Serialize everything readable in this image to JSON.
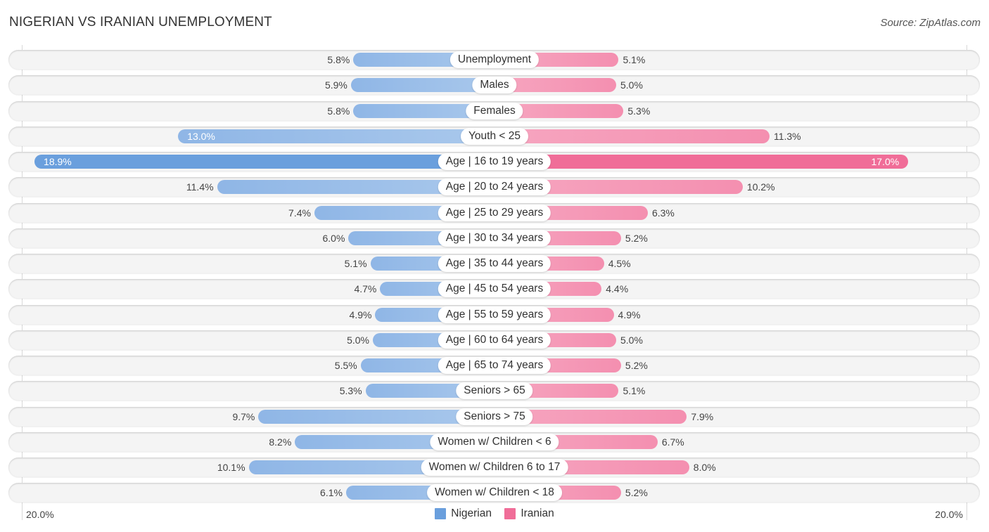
{
  "header": {
    "title": "NIGERIAN VS IRANIAN UNEMPLOYMENT",
    "source": "Source: ZipAtlas.com"
  },
  "colors": {
    "nigerian": "#6a9fdd",
    "iranian": "#f06d98",
    "nigerian_light": "#a3c4ea",
    "iranian_light": "#f6a2bd"
  },
  "chart_data": {
    "type": "bar",
    "orientation": "horizontal-diverging",
    "title": "NIGERIAN VS IRANIAN UNEMPLOYMENT",
    "categories": [
      "Unemployment",
      "Males",
      "Females",
      "Youth < 25",
      "Age | 16 to 19 years",
      "Age | 20 to 24 years",
      "Age | 25 to 29 years",
      "Age | 30 to 34 years",
      "Age | 35 to 44 years",
      "Age | 45 to 54 years",
      "Age | 55 to 59 years",
      "Age | 60 to 64 years",
      "Age | 65 to 74 years",
      "Seniors > 65",
      "Seniors > 75",
      "Women w/ Children < 6",
      "Women w/ Children 6 to 17",
      "Women w/ Children < 18"
    ],
    "series": [
      {
        "name": "Nigerian",
        "side": "left",
        "values": [
          5.8,
          5.9,
          5.8,
          13.0,
          18.9,
          11.4,
          7.4,
          6.0,
          5.1,
          4.7,
          4.9,
          5.0,
          5.5,
          5.3,
          9.7,
          8.2,
          10.1,
          6.1
        ]
      },
      {
        "name": "Iranian",
        "side": "right",
        "values": [
          5.1,
          5.0,
          5.3,
          11.3,
          17.0,
          10.2,
          6.3,
          5.2,
          4.5,
          4.4,
          4.9,
          5.0,
          5.2,
          5.1,
          7.9,
          6.7,
          8.0,
          5.2
        ]
      }
    ],
    "value_format": "{v}%",
    "xlim": [
      -20.0,
      20.0
    ],
    "axis_labels": {
      "left": "20.0%",
      "right": "20.0%"
    },
    "legend": {
      "position": "bottom-center",
      "entries": [
        "Nigerian",
        "Iranian"
      ]
    },
    "grid": false
  }
}
